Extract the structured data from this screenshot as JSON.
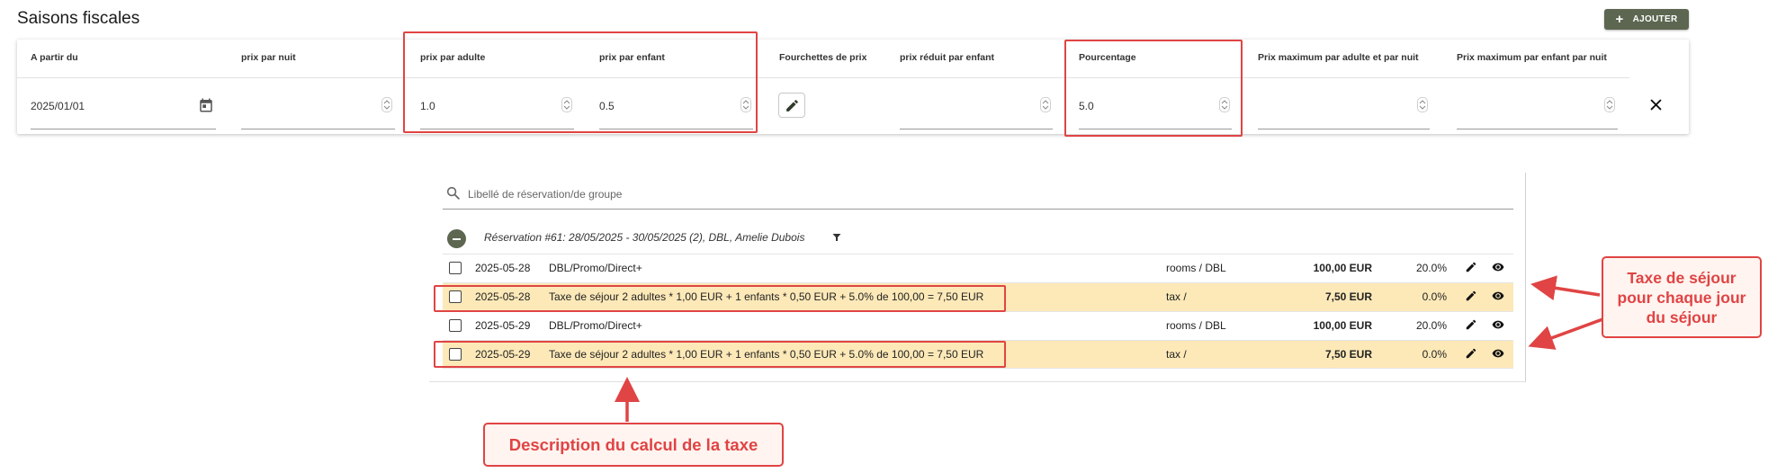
{
  "header": {
    "title": "Saisons fiscales",
    "add_button_label": "AJOUTER"
  },
  "columns": [
    {
      "key": "a_partir_du",
      "label": "A partir du"
    },
    {
      "key": "prix_par_nuit",
      "label": "prix par nuit"
    },
    {
      "key": "prix_par_adulte",
      "label": "prix par adulte"
    },
    {
      "key": "prix_par_enfant",
      "label": "prix par enfant"
    },
    {
      "key": "fourchettes",
      "label": "Fourchettes de prix"
    },
    {
      "key": "prix_reduit_enfant",
      "label": "prix réduit par enfant"
    },
    {
      "key": "pourcentage",
      "label": "Pourcentage"
    },
    {
      "key": "prix_max_adulte",
      "label": "Prix maximum par adulte et par nuit"
    },
    {
      "key": "prix_max_enfant",
      "label": "Prix maximum par enfant par nuit"
    }
  ],
  "season_row": {
    "a_partir_du": "2025/01/01",
    "prix_par_nuit": "",
    "prix_par_adulte": "1.0",
    "prix_par_enfant": "0.5",
    "prix_reduit_enfant": "",
    "pourcentage": "5.0",
    "prix_max_adulte": "",
    "prix_max_enfant": ""
  },
  "reservations": {
    "search_placeholder": "Libellé de réservation/de groupe",
    "group_label": "Réservation #61: 28/05/2025 - 30/05/2025 (2), DBL, Amelie Dubois",
    "rows": [
      {
        "date": "2025-05-28",
        "description": "DBL/Promo/Direct+",
        "category": "rooms / DBL",
        "amount": "100,00 EUR",
        "tax": "20.0%",
        "highlighted": false
      },
      {
        "date": "2025-05-28",
        "description": "Taxe de séjour 2 adultes * 1,00 EUR + 1 enfants * 0,50 EUR + 5.0% de 100,00 = 7,50 EUR",
        "category": "tax /",
        "amount": "7,50 EUR",
        "tax": "0.0%",
        "highlighted": true
      },
      {
        "date": "2025-05-29",
        "description": "DBL/Promo/Direct+",
        "category": "rooms / DBL",
        "amount": "100,00 EUR",
        "tax": "20.0%",
        "highlighted": false
      },
      {
        "date": "2025-05-29",
        "description": "Taxe de séjour 2 adultes * 1,00 EUR + 1 enfants * 0,50 EUR + 5.0% de 100,00 = 7,50 EUR",
        "category": "tax /",
        "amount": "7,50 EUR",
        "tax": "0.0%",
        "highlighted": true
      }
    ]
  },
  "annotations": {
    "taxe_callout_lines": [
      "Taxe de séjour",
      "pour chaque jour",
      "du séjour"
    ],
    "description_callout": "Description du calcul de la taxe",
    "color": "#e04444"
  },
  "colors": {
    "accent": "#5c6650",
    "highlight_row": "#fde9b8"
  }
}
